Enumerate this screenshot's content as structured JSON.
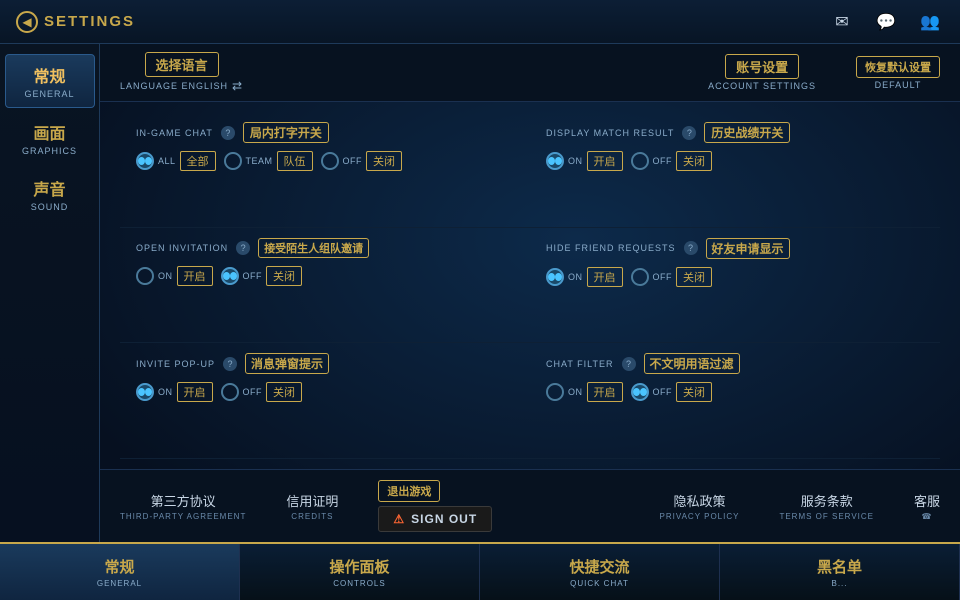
{
  "header": {
    "back_label": "◀",
    "title": "SETTINGS",
    "icons": [
      "envelope",
      "chat",
      "people"
    ]
  },
  "sidebar": {
    "items": [
      {
        "cn": "常规",
        "en": "GENERAL",
        "active": true
      },
      {
        "cn": "画面",
        "en": "GRAPHICS",
        "active": false
      },
      {
        "cn": "声音",
        "en": "SOUND",
        "active": false
      }
    ]
  },
  "top_bar": {
    "language_cn": "选择语言",
    "language_label": "LANGUAGE ENGLISH",
    "swap_symbol": "⇄",
    "account_cn": "账号设置",
    "account_en": "ACCOUNT SETTINGS",
    "default_cn": "恢复默认设置",
    "default_en": "DEFAULT"
  },
  "settings": [
    {
      "id": "in-game-chat",
      "en_label": "IN-GAME CHAT",
      "cn_label": "局内打字开关",
      "has_info": true,
      "options": [
        {
          "id": "all",
          "en": "ALL",
          "cn": "全部",
          "selected": true
        },
        {
          "id": "team",
          "en": "TEAM",
          "cn": "队伍",
          "selected": false
        },
        {
          "id": "off",
          "en": "OFF",
          "cn": "关闭",
          "selected": false
        }
      ]
    },
    {
      "id": "display-match-result",
      "en_label": "DISPLAY MATCH RESULT",
      "cn_label": "历史战绩开关",
      "has_info": true,
      "options": [
        {
          "id": "on",
          "en": "ON",
          "cn": "开启",
          "selected": true
        },
        {
          "id": "off",
          "en": "OFF",
          "cn": "关闭",
          "selected": false
        }
      ]
    },
    {
      "id": "open-invitation",
      "en_label": "OPEN INVITATION",
      "cn_label": "接受陌生人组队邀请",
      "has_info": true,
      "options": [
        {
          "id": "on",
          "en": "ON",
          "cn": "开启",
          "selected": false
        },
        {
          "id": "off",
          "en": "OFF",
          "cn": "关闭",
          "selected": true
        }
      ]
    },
    {
      "id": "hide-friend-requests",
      "en_label": "HIDE FRIEND REQUESTS",
      "cn_label": "好友申请显示",
      "has_info": true,
      "options": [
        {
          "id": "on",
          "en": "ON",
          "cn": "开启",
          "selected": true
        },
        {
          "id": "off",
          "en": "OFF",
          "cn": "关闭",
          "selected": false
        }
      ]
    },
    {
      "id": "invite-popup",
      "en_label": "INVITE POP-UP",
      "cn_label": "消息弹窗提示",
      "has_info": true,
      "options": [
        {
          "id": "on",
          "en": "ON",
          "cn": "开启",
          "selected": true
        },
        {
          "id": "off",
          "en": "OFF",
          "cn": "关闭",
          "selected": false
        }
      ]
    },
    {
      "id": "chat-filter",
      "en_label": "CHAT FILTER",
      "cn_label": "不文明用语过滤",
      "has_info": true,
      "options": [
        {
          "id": "on",
          "en": "ON",
          "cn": "开启",
          "selected": false
        },
        {
          "id": "off",
          "en": "OFF",
          "cn": "关闭",
          "selected": true
        }
      ]
    }
  ],
  "bottom_links": {
    "third_party_cn": "第三方协议",
    "third_party_en": "THIRD-PARTY AGREEMENT",
    "credits_cn": "信用证明",
    "credits_en": "CREDITS",
    "sign_out_cn": "退出游戏",
    "sign_out_en": "SIGN OUT",
    "privacy_cn": "隐私政策",
    "privacy_en": "PRIVACY POLICY",
    "tos_cn": "服务条款",
    "tos_en": "TERMS OF SERVICE",
    "cs_cn": "客服",
    "cs_en": "☎"
  },
  "tab_bar": {
    "tabs": [
      {
        "cn": "常规",
        "en": "GENERAL",
        "active": true
      },
      {
        "cn": "操作面板",
        "en": "CONTROLS",
        "active": false
      },
      {
        "cn": "快捷交流",
        "en": "QUICK CHAT",
        "active": false
      },
      {
        "cn": "黑名单",
        "en": "B...",
        "active": false
      }
    ]
  },
  "colors": {
    "gold": "#c8a84b",
    "blue_accent": "#4ac4ff",
    "bg_dark": "#061020",
    "text_light": "#c8d6e5"
  }
}
